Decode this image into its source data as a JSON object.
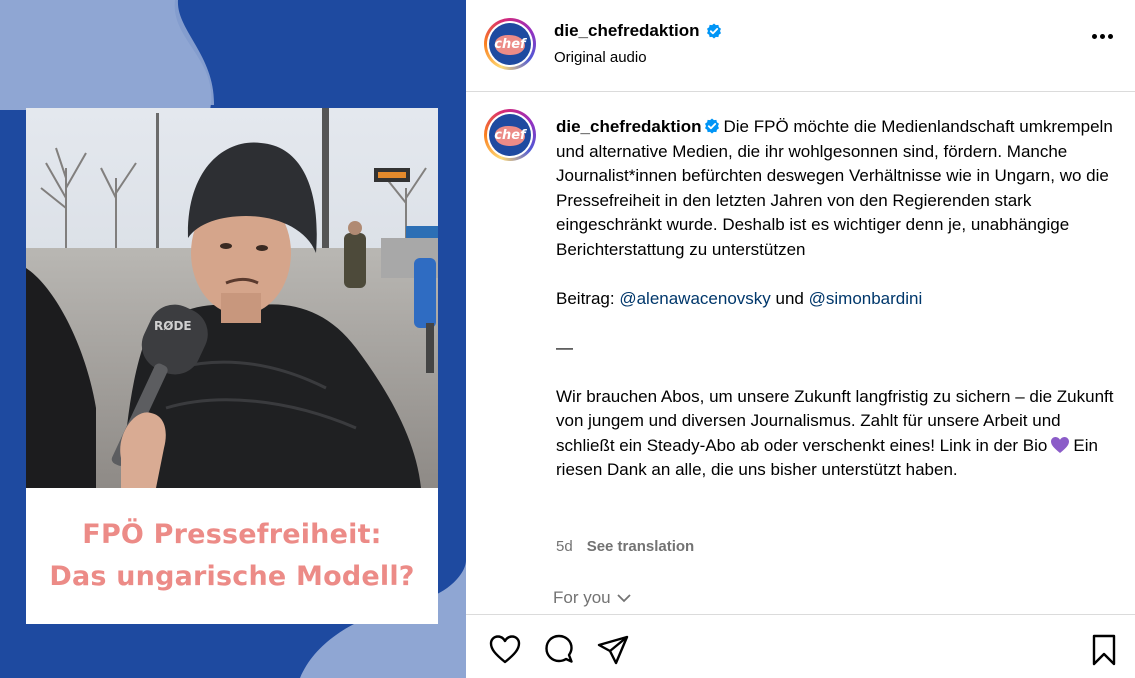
{
  "post": {
    "username": "die_chefredaktion",
    "audio": "Original audio",
    "avatar_text": "chef"
  },
  "media": {
    "caption_line1": "FPÖ Pressefreiheit:",
    "caption_line2": "Das ungarische Modell?",
    "mic_brand": "RØDE"
  },
  "caption": {
    "username": "die_chefredaktion",
    "paragraph1": "Die FPÖ möchte die Medienlandschaft umkrempeln und alternative Medien, die ihr wohlgesonnen sind, fördern. Manche Journalist*innen befürchten deswegen Verhältnisse wie in Ungarn, wo die Pressefreiheit in den letzten Jahren von den Regierenden stark eingeschränkt wurde. Deshalb ist es wichtiger denn je, unabhängige Berichterstattung zu unterstützen",
    "credits_prefix": "Beitrag:",
    "mention1": "@alenawacenovsky",
    "credits_and": "und",
    "mention2": "@simonbardini",
    "dash": "—",
    "paragraph3_a": "Wir brauchen Abos, um unsere Zukunft langfristig zu sichern – die Zukunft von jungem und diversen Journalismus. Zahlt für unsere Arbeit und schließt ein Steady-Abo ab oder verschenkt eines! Link in der Bio",
    "paragraph3_b": "Ein riesen Dank an alle, die uns bisher unterstützt haben.",
    "emoji": "purple-heart"
  },
  "meta": {
    "age": "5d",
    "see_translation": "See translation"
  },
  "for_you": "For you",
  "icons": {
    "like": "heart-icon",
    "comment": "comment-icon",
    "share": "share-icon",
    "save": "bookmark-icon",
    "more": "more-icon"
  },
  "colors": {
    "brand_blue": "#1e4aa0",
    "brand_pink": "#ec8b87",
    "verified": "#0095f6",
    "mention": "#00376b",
    "muted": "#737373"
  }
}
